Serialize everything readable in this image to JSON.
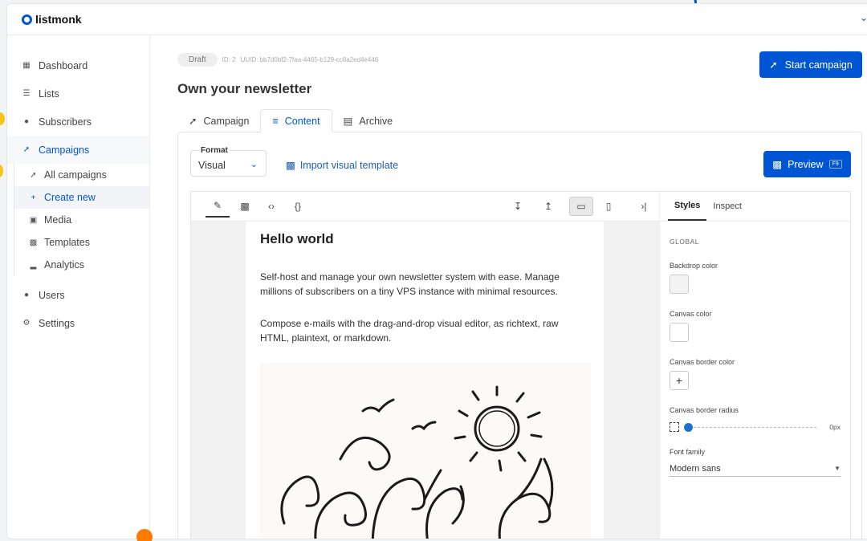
{
  "app": {
    "name": "listmonk"
  },
  "sidebar": {
    "items": [
      {
        "label": "Dashboard",
        "icon": "dashboard-icon"
      },
      {
        "label": "Lists",
        "icon": "list-icon"
      },
      {
        "label": "Subscribers",
        "icon": "users-icon"
      },
      {
        "label": "Campaigns",
        "icon": "rocket-icon"
      }
    ],
    "campaign_subitems": [
      {
        "label": "All campaigns",
        "icon": "rocket-icon"
      },
      {
        "label": "Create new",
        "icon": "plus-icon"
      },
      {
        "label": "Media",
        "icon": "image-icon"
      },
      {
        "label": "Templates",
        "icon": "file-icon"
      },
      {
        "label": "Analytics",
        "icon": "chart-icon"
      }
    ],
    "bottom_items": [
      {
        "label": "Users",
        "icon": "users-icon"
      },
      {
        "label": "Settings",
        "icon": "gear-icon"
      }
    ]
  },
  "campaign": {
    "status": "Draft",
    "id_text": "ID: 2",
    "uuid_text": "UUID: bb7d0bf2-7faa-4465-b129-cc8a2ed4e446",
    "title": "Own your newsletter",
    "start_button": "Start campaign"
  },
  "tabs": [
    {
      "label": "Campaign",
      "icon": "rocket-icon"
    },
    {
      "label": "Content",
      "icon": "align-icon"
    },
    {
      "label": "Archive",
      "icon": "newspaper-icon"
    }
  ],
  "content": {
    "format_label": "Format",
    "format_value": "Visual",
    "import_link": "Import visual template",
    "preview_button": "Preview",
    "preview_shortcut": "F9"
  },
  "editor": {
    "heading": "Hello world",
    "paragraph1": "Self-host and manage your own newsletter system with ease. Manage millions of subscribers on a tiny VPS instance with minimal resources.",
    "paragraph2": "Compose e-mails with the drag-and-drop visual editor, as richtext, raw HTML, plaintext, or markdown."
  },
  "style_panel": {
    "tabs": [
      "Styles",
      "Inspect"
    ],
    "section": "GLOBAL",
    "backdrop_color_label": "Backdrop color",
    "canvas_color_label": "Canvas color",
    "canvas_border_color_label": "Canvas border color",
    "canvas_border_radius_label": "Canvas border radius",
    "border_radius_value": "0px",
    "font_family_label": "Font family",
    "font_family_value": "Modern sans"
  },
  "colors": {
    "accent": "#0055d4",
    "backdrop_swatch": "#f3f3f3",
    "canvas_swatch": "#ffffff"
  }
}
